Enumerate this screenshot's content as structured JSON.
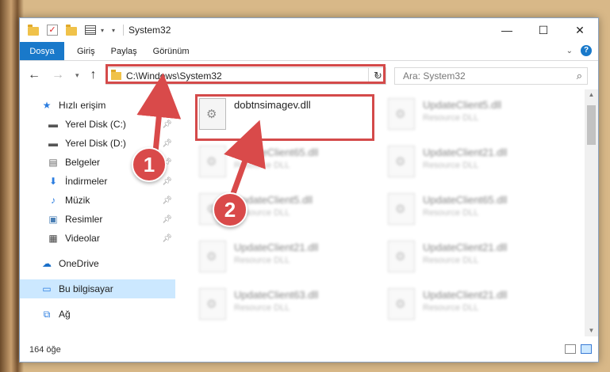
{
  "window": {
    "title": "System32",
    "controls": {
      "minimize": "—",
      "maximize": "☐",
      "close": "✕"
    }
  },
  "ribbon": {
    "tabs": [
      "Dosya",
      "Giriş",
      "Paylaş",
      "Görünüm"
    ],
    "help": "?"
  },
  "addressbar": {
    "path": "C:\\Windows\\System32",
    "search_placeholder": "Ara: System32"
  },
  "sidebar": {
    "items": [
      {
        "label": "Hızlı erişim",
        "icon": "star-icon",
        "pinned": false
      },
      {
        "label": "Yerel Disk (C:)",
        "icon": "drive-icon",
        "pinned": true
      },
      {
        "label": "Yerel Disk (D:)",
        "icon": "drive-icon",
        "pinned": true
      },
      {
        "label": "Belgeler",
        "icon": "document-icon",
        "pinned": true
      },
      {
        "label": "İndirmeler",
        "icon": "download-icon",
        "pinned": true
      },
      {
        "label": "Müzik",
        "icon": "music-icon",
        "pinned": true
      },
      {
        "label": "Resimler",
        "icon": "picture-icon",
        "pinned": true
      },
      {
        "label": "Videolar",
        "icon": "video-icon",
        "pinned": true
      },
      {
        "label": "OneDrive",
        "icon": "cloud-icon",
        "pinned": false
      },
      {
        "label": "Bu bilgisayar",
        "icon": "computer-icon",
        "pinned": false,
        "selected": true
      },
      {
        "label": "Ağ",
        "icon": "network-icon",
        "pinned": false
      }
    ]
  },
  "files": [
    {
      "name": "dobtnsimagev.dll",
      "type": ""
    },
    {
      "name": "UpdateClient5.dll",
      "type": "Resource DLL"
    },
    {
      "name": "UpdateClient65.dll",
      "type": "Resource DLL"
    },
    {
      "name": "UpdateClient21.dll",
      "type": "Resource DLL"
    },
    {
      "name": "UpdateClient5.dll",
      "type": "Resource DLL"
    },
    {
      "name": "UpdateClient65.dll",
      "type": "Resource DLL"
    },
    {
      "name": "UpdateClient21.dll",
      "type": "Resource DLL"
    },
    {
      "name": "UpdateClient21.dll",
      "type": "Resource DLL"
    },
    {
      "name": "UpdateClient63.dll",
      "type": "Resource DLL"
    },
    {
      "name": "UpdateClient21.dll",
      "type": "Resource DLL"
    }
  ],
  "status": {
    "count": "164 öğe"
  },
  "callouts": [
    "1",
    "2"
  ],
  "colors": {
    "accent": "#1979ca",
    "highlight": "#d44a4a",
    "selection": "#cce8ff"
  }
}
